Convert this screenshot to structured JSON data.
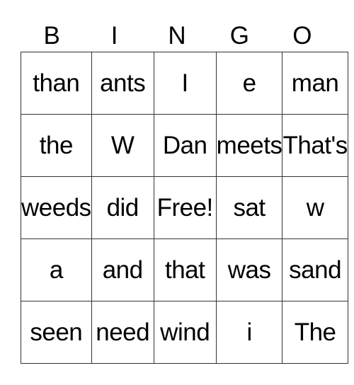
{
  "header": [
    "B",
    "I",
    "N",
    "G",
    "O"
  ],
  "grid": [
    [
      "than",
      "ants",
      "I",
      "e",
      "man"
    ],
    [
      "the",
      "W",
      "Dan",
      "meets",
      "That's"
    ],
    [
      "weeds",
      "did",
      "Free!",
      "sat",
      "w"
    ],
    [
      "a",
      "and",
      "that",
      "was",
      "sand"
    ],
    [
      "seen",
      "need",
      "wind",
      "i",
      "The"
    ]
  ]
}
